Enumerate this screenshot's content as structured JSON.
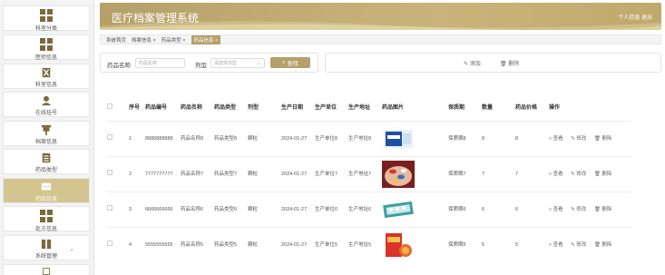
{
  "sidebar": {
    "items": [
      {
        "label": "科室分类",
        "icon": "grid-icon",
        "active": false
      },
      {
        "label": "医师信息",
        "icon": "grid-icon",
        "active": false
      },
      {
        "label": "科室信息",
        "icon": "hourglass-icon",
        "active": false
      },
      {
        "label": "在线挂号",
        "icon": "user-icon",
        "active": false
      },
      {
        "label": "档案信息",
        "icon": "pin-icon",
        "active": false
      },
      {
        "label": "药品类型",
        "icon": "document-icon",
        "active": false
      },
      {
        "label": "药品信息",
        "icon": "chat-icon",
        "active": true
      },
      {
        "label": "处方信息",
        "icon": "grid-icon",
        "active": false
      },
      {
        "label": "系统管理",
        "icon": "book-icon",
        "active": false
      }
    ]
  },
  "header": {
    "title": "医疗档案管理系统",
    "user_links": "个人信息 退出"
  },
  "tabs": [
    {
      "label": "系统首页",
      "active": false
    },
    {
      "label": "档案信息 ×",
      "active": false
    },
    {
      "label": "药品类型 ×",
      "active": false
    },
    {
      "label": "药品信息 ×",
      "active": true
    }
  ],
  "search": {
    "name_label": "药品名称",
    "name_placeholder": "药品名称",
    "type_label": "剂型",
    "type_placeholder": "请选择剂型",
    "button": "查找"
  },
  "actions": {
    "add": "添加",
    "delete": "删除"
  },
  "table": {
    "headers": [
      "序号",
      "药品编号",
      "药品名称",
      "药品类型",
      "剂型",
      "生产日期",
      "生产单位",
      "生产地址",
      "药品图片",
      "保质期",
      "数量",
      "药品价格",
      "操作"
    ],
    "rows": [
      {
        "index": "1",
        "code": "8888888888",
        "name": "药品名称8",
        "type": "药品类型8",
        "form": "颗粒",
        "date": "2024-01-27",
        "unit": "生产单位8",
        "address": "生产地址8",
        "picture": "pill-box-blue",
        "shelf": "保质期8",
        "qty": "8",
        "price": "8"
      },
      {
        "index": "2",
        "code": "7777777777",
        "name": "药品名称7",
        "type": "药品类型7",
        "form": "颗粒",
        "date": "2024-01-27",
        "unit": "生产单位7",
        "address": "生产地址7",
        "picture": "pills-hand",
        "shelf": "保质期7",
        "qty": "7",
        "price": "7"
      },
      {
        "index": "3",
        "code": "6666666666",
        "name": "药品名称6",
        "type": "药品类型6",
        "form": "颗粒",
        "date": "2024-01-27",
        "unit": "生产单位6",
        "address": "生产地址6",
        "picture": "tablet-strip",
        "shelf": "保质期6",
        "qty": "6",
        "price": "6"
      },
      {
        "index": "4",
        "code": "5555555555",
        "name": "药品名称5",
        "type": "药品类型5",
        "form": "颗粒",
        "date": "2024-01-27",
        "unit": "生产单位5",
        "address": "生产地址5",
        "picture": "medicine-box-red",
        "shelf": "保质期5",
        "qty": "5",
        "price": "5"
      }
    ],
    "ops": {
      "view": "查看",
      "edit": "修改",
      "delete": "删除"
    }
  }
}
